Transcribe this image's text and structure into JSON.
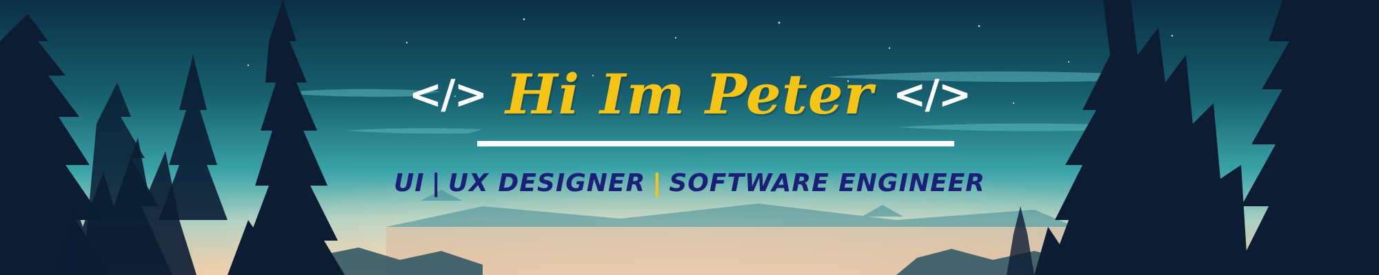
{
  "banner": {
    "open_tag": "</>",
    "close_tag": "</>",
    "greeting": "Hi Im Peter",
    "subtitle": {
      "role_1": "UI",
      "separator_1": "|",
      "role_2": "UX DESIGNER",
      "separator_2": "|",
      "role_3": "SOFTWARE ENGINEER"
    }
  },
  "colors": {
    "greeting": "#f6c414",
    "tags": "#ffffff",
    "subtitle": "#1b1f78",
    "accent_separator": "#f6c414",
    "sky_top": "#0b2f45",
    "sky_mid": "#1f7f8c",
    "horizon": "#e7c5a6",
    "tree_silhouette": "#0b1c33"
  }
}
